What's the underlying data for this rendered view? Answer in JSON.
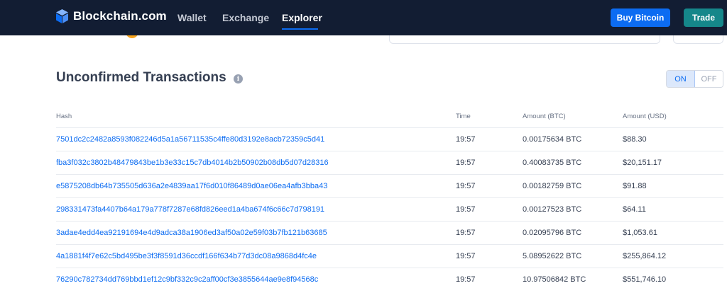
{
  "nav": {
    "brand": "Blockchain.com",
    "links": [
      {
        "label": "Wallet",
        "active": false
      },
      {
        "label": "Exchange",
        "active": false
      },
      {
        "label": "Explorer",
        "active": true
      }
    ],
    "buy_label": "Buy Bitcoin",
    "trade_label": "Trade"
  },
  "section": {
    "title": "Unconfirmed Transactions",
    "info_icon": "i",
    "toggle_on": "ON",
    "toggle_off": "OFF"
  },
  "table": {
    "headers": [
      "Hash",
      "Time",
      "Amount (BTC)",
      "Amount (USD)"
    ],
    "rows": [
      {
        "hash": "7501dc2c2482a8593f082246d5a1a56711535c4ffe80d3192e8acb72359c5d41",
        "time": "19:57",
        "btc": "0.00175634 BTC",
        "usd": "$88.30"
      },
      {
        "hash": "fba3f032c3802b48479843be1b3e33c15c7db4014b2b50902b08db5d07d28316",
        "time": "19:57",
        "btc": "0.40083735 BTC",
        "usd": "$20,151.17"
      },
      {
        "hash": "e5875208db64b735505d636a2e4839aa17f6d010f86489d0ae06ea4afb3bba43",
        "time": "19:57",
        "btc": "0.00182759 BTC",
        "usd": "$91.88"
      },
      {
        "hash": "298331473fa4407b64a179a778f7287e68fd826eed1a4ba674f6c66c7d798191",
        "time": "19:57",
        "btc": "0.00127523 BTC",
        "usd": "$64.11"
      },
      {
        "hash": "3adae4edd4ea92191694e4d9adca38a1906ed3af50a02e59f03b7fb121b63685",
        "time": "19:57",
        "btc": "0.02095796 BTC",
        "usd": "$1,053.61"
      },
      {
        "hash": "4a1881f4f7e62c5bd495be3f3f8591d36ccdf166f634b77d3dc08a9868d4fc4e",
        "time": "19:57",
        "btc": "5.08952622 BTC",
        "usd": "$255,864.12"
      },
      {
        "hash": "76290c782734dd769bbd1ef12c9bf332c9c2aff00cf3e3855644ae9e8f94568c",
        "time": "19:57",
        "btc": "10.97506842 BTC",
        "usd": "$551,746.10"
      }
    ]
  },
  "colors": {
    "nav_bg": "#121d33",
    "accent": "#0c6cf2",
    "trade": "#15878a"
  }
}
